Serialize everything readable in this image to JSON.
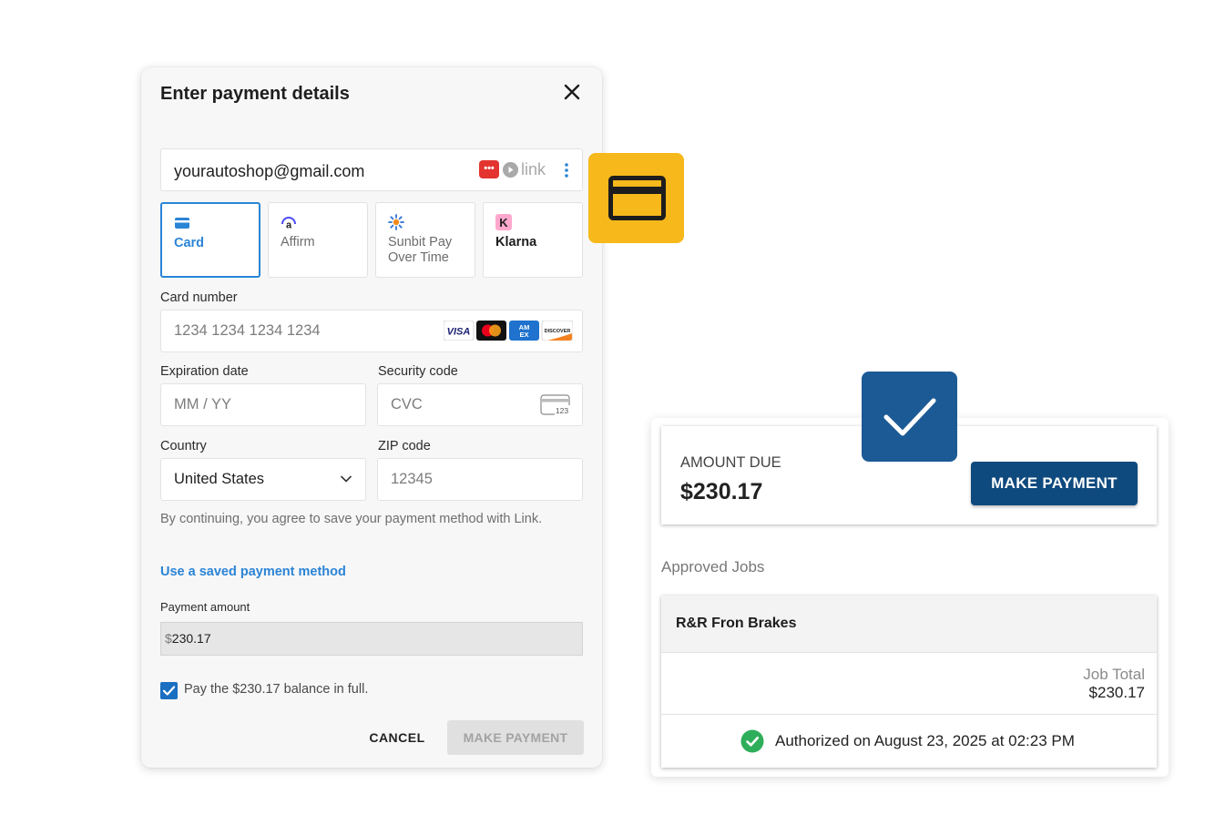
{
  "dialog": {
    "title": "Enter payment details",
    "email": "yourautoshop@gmail.com",
    "link_badge": "•••",
    "link_word": "link",
    "methods": [
      {
        "label": "Card",
        "icon": "card-icon",
        "active": true
      },
      {
        "label": "Affirm",
        "icon": "affirm-icon",
        "active": false
      },
      {
        "label": "Sunbit Pay\nOver Time",
        "icon": "sunbit-icon",
        "active": false
      },
      {
        "label": "Klarna",
        "icon": "klarna-icon",
        "active": false
      }
    ],
    "card_number": {
      "label": "Card number",
      "placeholder": "1234 1234 1234 1234"
    },
    "card_brands": [
      "VISA",
      "Mastercard",
      "AMEX",
      "DISCOVER"
    ],
    "expiration": {
      "label": "Expiration date",
      "placeholder": "MM / YY"
    },
    "security": {
      "label": "Security code",
      "placeholder": "CVC",
      "icon_text": "123"
    },
    "country": {
      "label": "Country",
      "value": "United States"
    },
    "zip": {
      "label": "ZIP code",
      "placeholder": "12345"
    },
    "consent": "By continuing, you agree to save your payment method with Link.",
    "saved_link": "Use a saved payment method",
    "amount_label": "Payment amount",
    "amount_prefix": "$",
    "amount_value": "230.17",
    "checkbox_label": "Pay the $230.17 balance in full.",
    "checkbox_checked": true,
    "cancel": "CANCEL",
    "make_payment": "MAKE PAYMENT"
  },
  "panel": {
    "due_label": "AMOUNT DUE",
    "due_value": "$230.17",
    "make_payment": "MAKE PAYMENT",
    "approved_label": "Approved Jobs",
    "job_name": "R&R Fron Brakes",
    "job_total_label": "Job Total",
    "job_total_value": "$230.17",
    "authorized_text": "Authorized on August 23, 2025 at 02:23 PM"
  },
  "colors": {
    "accent_blue": "#2a84d6",
    "primary_navy": "#0f4a7e",
    "badge_yellow": "#f6b81a",
    "badge_blue": "#1c5a95",
    "success_green": "#2eae5a"
  }
}
